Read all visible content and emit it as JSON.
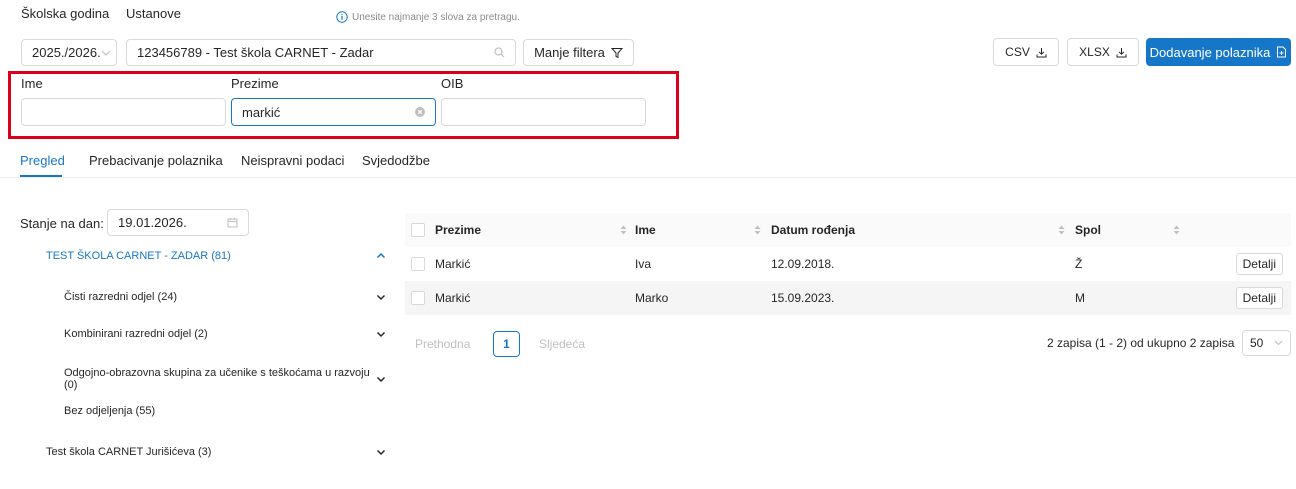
{
  "filters": {
    "school_year_label": "Školska godina",
    "institution_label": "Ustanove",
    "hint": "Unesite najmanje 3 slova za pretragu.",
    "school_year_value": "2025./2026.",
    "institution_value": "123456789 - Test škola CARNET - Zadar",
    "less_filters_label": "Manje filtera",
    "first_name_label": "Ime",
    "last_name_label": "Prezime",
    "oib_label": "OIB",
    "first_name_value": "",
    "last_name_value": "markić",
    "oib_value": ""
  },
  "toolbar": {
    "csv_label": "CSV",
    "xlsx_label": "XLSX",
    "add_student_label": "Dodavanje polaznika"
  },
  "tabs": [
    {
      "label": "Pregled",
      "active": true
    },
    {
      "label": "Prebacivanje polaznika"
    },
    {
      "label": "Neispravni podaci"
    },
    {
      "label": "Svjedodžbe"
    }
  ],
  "sidebar": {
    "date_label": "Stanje na dan:",
    "date_value": "19.01.2026.",
    "items": [
      {
        "label": "TEST ŠKOLA CARNET - ZADAR (81)",
        "expanded": true
      },
      {
        "label": "Čisti razredni odjel (24)"
      },
      {
        "label": "Kombinirani razredni odjel (2)"
      },
      {
        "label": "Odgojno-obrazovna skupina za učenike s teškoćama u razvoju (0)"
      },
      {
        "label": "Bez odjeljenja (55)"
      },
      {
        "label": "Test škola CARNET Jurišićeva (3)"
      }
    ]
  },
  "table": {
    "columns": [
      "Prezime",
      "Ime",
      "Datum rođenja",
      "Spol"
    ],
    "rows": [
      {
        "prezime": "Markić",
        "ime": "Iva",
        "datum": "12.09.2018.",
        "spol": "Ž",
        "action": "Detalji"
      },
      {
        "prezime": "Markić",
        "ime": "Marko",
        "datum": "15.09.2023.",
        "spol": "M",
        "action": "Detalji"
      }
    ]
  },
  "pagination": {
    "prev_label": "Prethodna",
    "current_page": "1",
    "next_label": "Sljedeća",
    "summary": "2 zapisa (1 - 2) od ukupno 2 zapisa",
    "page_size": "50"
  },
  "colors": {
    "accent": "#1677c8",
    "highlight_border": "#d9001b"
  }
}
